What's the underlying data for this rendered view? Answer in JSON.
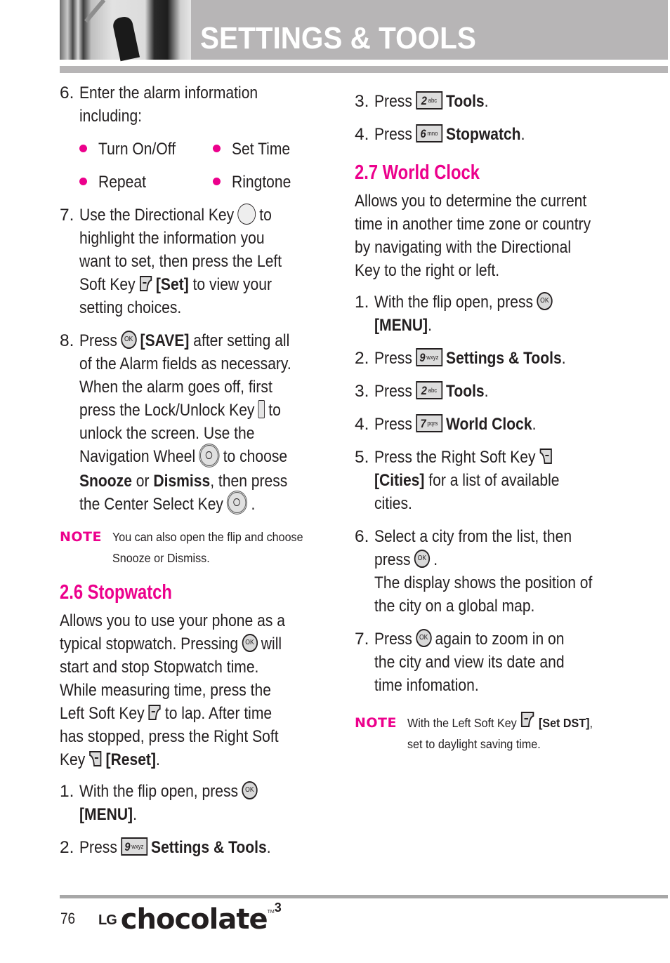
{
  "header": {
    "title": "SETTINGS & TOOLS"
  },
  "left": {
    "step6": {
      "num": "6.",
      "lines": [
        "Enter the alarm information",
        "including:"
      ]
    },
    "bullets": [
      "Turn On/Off",
      "Set Time",
      "Repeat",
      "Ringtone"
    ],
    "step7": {
      "num": "7.",
      "l1a": "Use the Directional Key",
      "l1b": "to",
      "l2": "highlight  the information you",
      "l3": "want to set, then press the Left",
      "l4a": "Soft Key",
      "l4b": "[Set]",
      "l4c": " to view your",
      "l5": "setting choices."
    },
    "step8": {
      "num": "8.",
      "l1a": "Press",
      "l1b": "[SAVE]",
      "l1c": " after setting all",
      "l2": "of the Alarm fields as necessary.",
      "l3": "When the alarm goes off, first",
      "l4a": "press the Lock/Unlock Key",
      "l4b": "to",
      "l5": "unlock the screen. Use the",
      "l6a": "Navigation Wheel",
      "l6b": "to choose",
      "l7a": "Snooze",
      "l7b": " or ",
      "l7c": "Dismiss",
      "l7d": ", then press",
      "l8a": "the Center Select Key",
      "l8b": "."
    },
    "note": {
      "label": "NOTE",
      "lines": [
        "You can also open the flip and choose",
        "Snooze or Dismiss."
      ]
    },
    "stopwatch": {
      "title": "2.6 Stopwatch",
      "p1": "Allows you to use your phone as a",
      "p2a": "typical stopwatch. Pressing",
      "p2b": "will",
      "p3": "start and stop Stopwatch time.",
      "p4": "While measuring time, press the",
      "p5a": "Left Soft Key",
      "p5b": "to lap. After time",
      "p6": "has stopped, press the Right Soft",
      "p7a": "Key",
      "p7b": "[Reset]",
      "p7c": ".",
      "s1": {
        "num": "1.",
        "a": "With the flip open, press",
        "b": "[MENU]",
        "c": "."
      },
      "s2": {
        "num": "2.",
        "a": "Press",
        "key": "9",
        "sub": "wxyz",
        "b": "Settings & Tools",
        "c": "."
      }
    }
  },
  "right": {
    "stopwatch_cont": {
      "s3": {
        "num": "3.",
        "a": "Press",
        "key": "2",
        "sub": "abc",
        "b": "Tools",
        "c": "."
      },
      "s4": {
        "num": "4.",
        "a": "Press",
        "key": "6",
        "sub": "mno",
        "b": "Stopwatch",
        "c": "."
      }
    },
    "worldclock": {
      "title": "2.7 World Clock",
      "para": [
        "Allows you to determine the current",
        "time in another time zone or country",
        "by navigating with the Directional",
        "Key to the right or left."
      ],
      "s1": {
        "num": "1.",
        "a": "With the flip open, press",
        "b": "[MENU]",
        "c": "."
      },
      "s2": {
        "num": "2.",
        "a": "Press",
        "key": "9",
        "sub": "wxyz",
        "b": "Settings & Tools",
        "c": "."
      },
      "s3": {
        "num": "3.",
        "a": "Press",
        "key": "2",
        "sub": "abc",
        "b": "Tools",
        "c": "."
      },
      "s4": {
        "num": "4.",
        "a": "Press",
        "key": "7",
        "sub": "pqrs",
        "b": "World Clock",
        "c": "."
      },
      "s5": {
        "num": "5.",
        "a": "Press the Right Soft Key",
        "b": "[Cities]",
        "c": " for a list of available",
        "d": "cities."
      },
      "s6": {
        "num": "6.",
        "a": "Select a city from the list, then",
        "b": "press",
        "c": ".",
        "d": "The display shows the position of",
        "e": "the city on a global map."
      },
      "s7": {
        "num": "7.",
        "a": "Press",
        "b": "again to zoom in on",
        "c": "the city and view its date and",
        "d": "time infomation."
      },
      "note": {
        "label": "NOTE",
        "a": "With the Left Soft Key",
        "b": "[Set DST]",
        "c": ",",
        "d": "set to daylight saving time."
      }
    }
  },
  "icons": {
    "ok_label": "OK"
  },
  "footer": {
    "page_number": "76",
    "brand_lg": "LG",
    "brand_name": "chocolate",
    "brand_tm": "TM",
    "brand_version": "3"
  },
  "colors": {
    "accent": "#ec008c",
    "header_gray": "#b7b5b6",
    "text": "#231f20"
  }
}
